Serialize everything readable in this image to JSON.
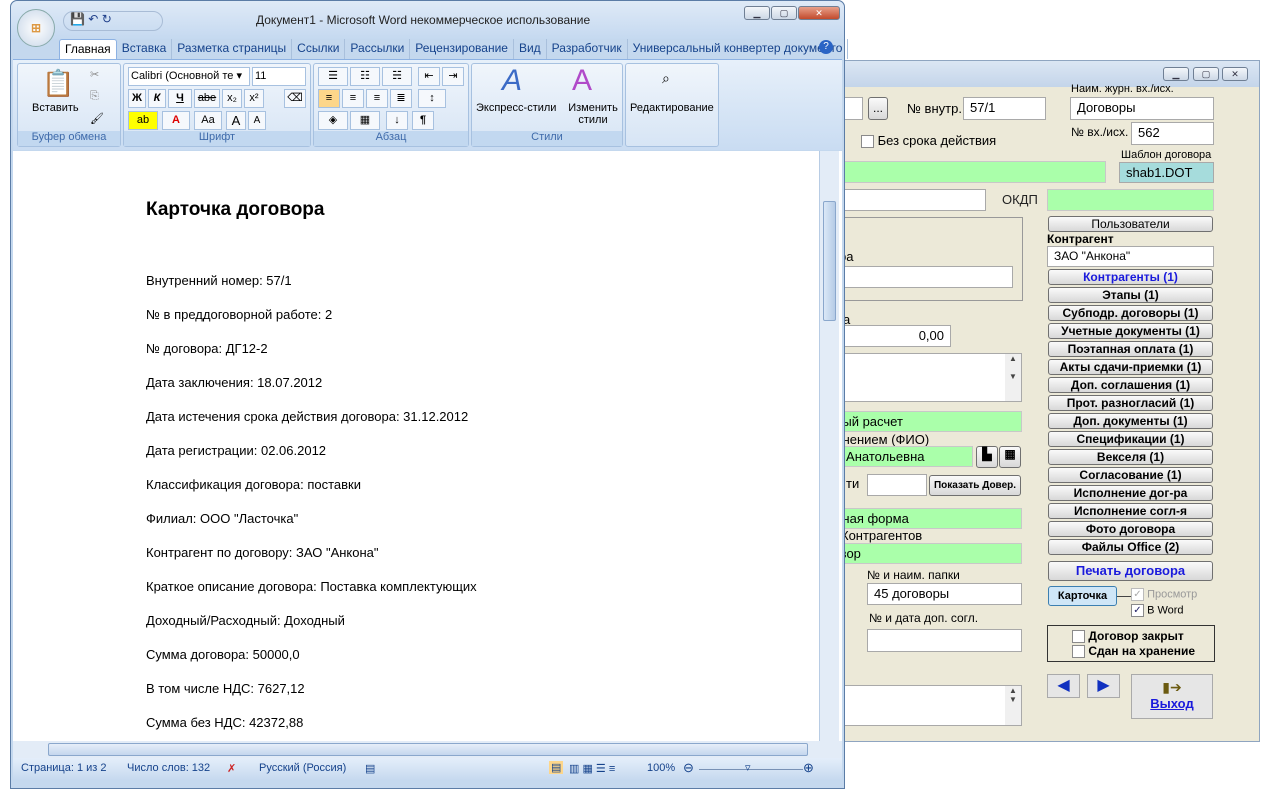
{
  "app": {
    "title_buttons": [
      "minimize",
      "maximize",
      "close"
    ],
    "pre_contract_no": "2",
    "browse_label": "...",
    "internal_no_label": "№ внутр.",
    "internal_no": "57/1",
    "journal_label": "Наим. журн. вх./исх.",
    "journal": "Договоры",
    "inout_no_label": "№ вх./исх.",
    "inout_no": "562",
    "no_term_label": "Без срока действия",
    "template_label": "Шаблон договора",
    "template": "shab1.DOT",
    "okdp_label": "ОКДП",
    "users_button": "Пользователи",
    "contractor_label": "Контрагент",
    "contractor": "ЗАО \"Анкона\"",
    "partial_label_1": "ра",
    "partial_label_2": "а",
    "amount": "0,00",
    "calc_type": "нный расчет",
    "exec_label": "полнением (ФИО)",
    "exec_person": "на Анатольевна",
    "partial_label_3": "ти",
    "show_power_button": "Показать Довер.",
    "form_field": "енная форма",
    "contractors_label": "Контрагентов",
    "contract_field": "говор",
    "folder_label": "№ и наим. папки",
    "folder": "45 договоры",
    "addendum_label": "№ и дата доп. согл.",
    "addendum": "",
    "buttons": [
      {
        "label": "Контрагенты (1)",
        "blue": true
      },
      {
        "label": "Этапы (1)"
      },
      {
        "label": "Субподр. договоры (1)"
      },
      {
        "label": "Учетные документы (1)"
      },
      {
        "label": "Поэтапная оплата (1)"
      },
      {
        "label": "Акты сдачи-приемки (1)"
      },
      {
        "label": "Доп. соглашения (1)"
      },
      {
        "label": "Прот. разногласий (1)"
      },
      {
        "label": "Доп. документы (1)"
      },
      {
        "label": "Спецификации (1)"
      },
      {
        "label": "Векселя (1)"
      },
      {
        "label": "Согласование (1)"
      },
      {
        "label": "Исполнение дог-ра"
      },
      {
        "label": "Исполнение согл-я"
      },
      {
        "label": "Фото договора"
      },
      {
        "label": "Файлы Office (2)"
      }
    ],
    "print_button": "Печать договора",
    "card_button": "Карточка",
    "preview_label": "Просмотр",
    "preview_checked": true,
    "in_word_label": "В Word",
    "in_word_checked": true,
    "closed_label": "Договор закрыт",
    "archived_label": "Сдан на хранение",
    "exit_label": "Выход"
  },
  "word": {
    "title": "Документ1 - Microsoft Word некоммерческое использование",
    "tabs": [
      "Главная",
      "Вставка",
      "Разметка страницы",
      "Ссылки",
      "Рассылки",
      "Рецензирование",
      "Вид",
      "Разработчик",
      "Универсальный конвертер документо"
    ],
    "ribbon": {
      "paste": "Вставить",
      "clipboard": "Буфер обмена",
      "font_name": "Calibri (Основной те",
      "font_size": "11",
      "font_group": "Шрифт",
      "bold": "Ж",
      "italic": "К",
      "underline": "Ч",
      "strike": "abe",
      "sub": "x₂",
      "sup": "x²",
      "case": "Aa",
      "grow": "A",
      "shrink": "A",
      "paragraph": "Абзац",
      "pilcrow": "¶",
      "quick_styles": "Экспресс-стили",
      "change_styles": "Изменить стили",
      "styles": "Стили",
      "editing": "Редактирование"
    },
    "doc_title": "Карточка договора",
    "doc_lines": [
      "Внутренний номер:  57/1",
      "№ в преддоговорной работе:  2",
      "№ договора:  ДГ12-2",
      "Дата заключения: 18.07.2012",
      "Дата истечения срока действия договора: 31.12.2012",
      "Дата регистрации: 02.06.2012",
      "Классификация договора: поставки",
      "Филиал: ООО \"Ласточка\"",
      "Контрагент по договору: ЗАО \"Анкона\"",
      "Краткое описание договора: Поставка комплектующих",
      "Доходный/Расходный: Доходный",
      "Сумма договора: 50000,0",
      "В том числе НДС: 7627,12",
      "Сумма без НДС: 42372,88"
    ],
    "status": {
      "page": "Страница: 1 из 2",
      "words": "Число слов: 132",
      "lang": "Русский (Россия)",
      "zoom": "100%"
    }
  }
}
